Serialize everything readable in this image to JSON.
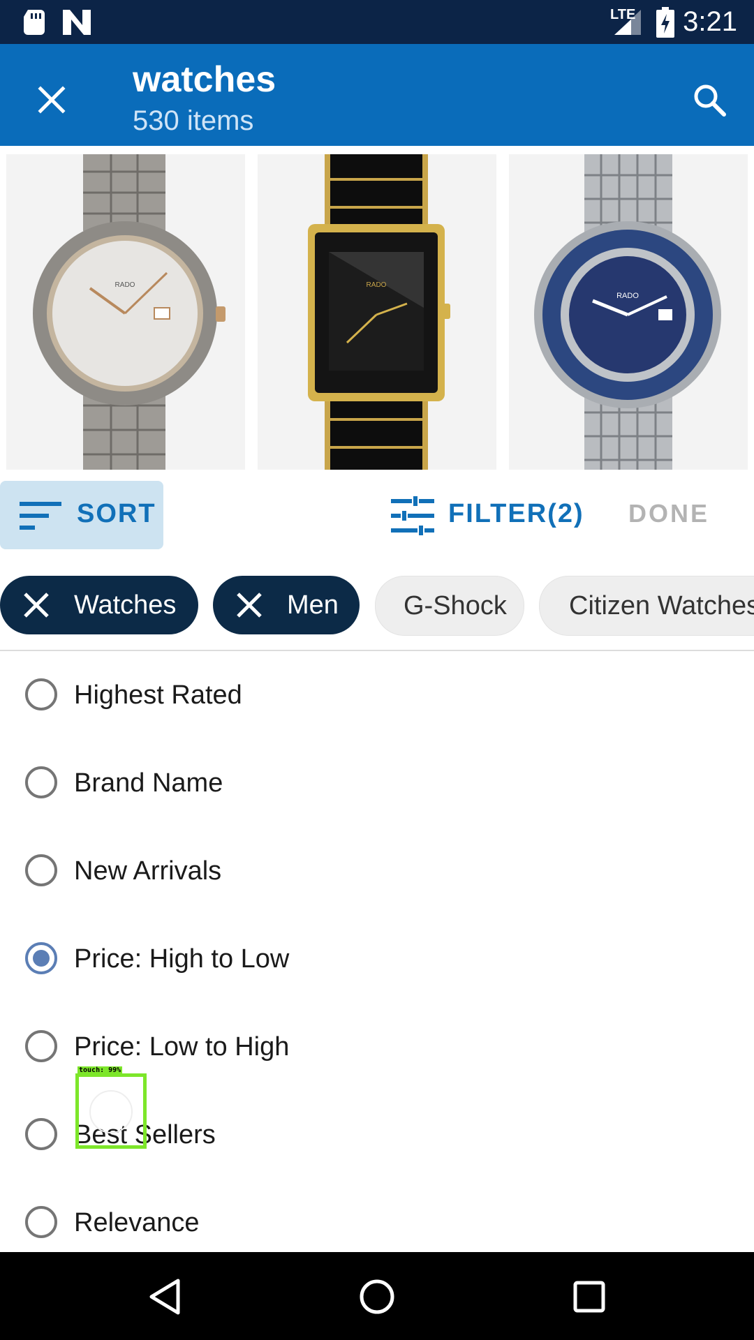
{
  "status_bar": {
    "time": "3:21",
    "icons": [
      "sd-card-icon",
      "n-logo-icon",
      "lte-signal-icon",
      "battery-charging-icon"
    ],
    "network_label": "LTE"
  },
  "app_bar": {
    "title": "watches",
    "subtitle": "530 items",
    "close_icon": "close-icon",
    "search_icon": "search-icon"
  },
  "products": [
    {
      "brand": "RADO",
      "style": "silver-rose"
    },
    {
      "brand": "RADO",
      "style": "black-gold"
    },
    {
      "brand": "RADO",
      "style": "blue-steel"
    }
  ],
  "toolbar": {
    "sort_label": "SORT",
    "filter_label": "FILTER(2)",
    "done_label": "DONE"
  },
  "chips": [
    {
      "label": "Watches",
      "active": true
    },
    {
      "label": "Men",
      "active": true
    },
    {
      "label": "G-Shock",
      "active": false
    },
    {
      "label": "Citizen Watches",
      "active": false
    }
  ],
  "sort_options": [
    {
      "label": "Highest Rated",
      "selected": false
    },
    {
      "label": "Brand Name",
      "selected": false
    },
    {
      "label": "New Arrivals",
      "selected": false
    },
    {
      "label": "Price: High to Low",
      "selected": true
    },
    {
      "label": "Price: Low to High",
      "selected": false
    },
    {
      "label": "Best Sellers",
      "selected": false
    },
    {
      "label": "Relevance",
      "selected": false
    }
  ],
  "touch_overlay": {
    "label": "touch: 99%"
  },
  "colors": {
    "status_bar": "#0c2447",
    "app_bar": "#0a6cba",
    "accent": "#1170b8",
    "chip_active": "#0c2a47",
    "radio_selected": "#5b7eb5"
  }
}
